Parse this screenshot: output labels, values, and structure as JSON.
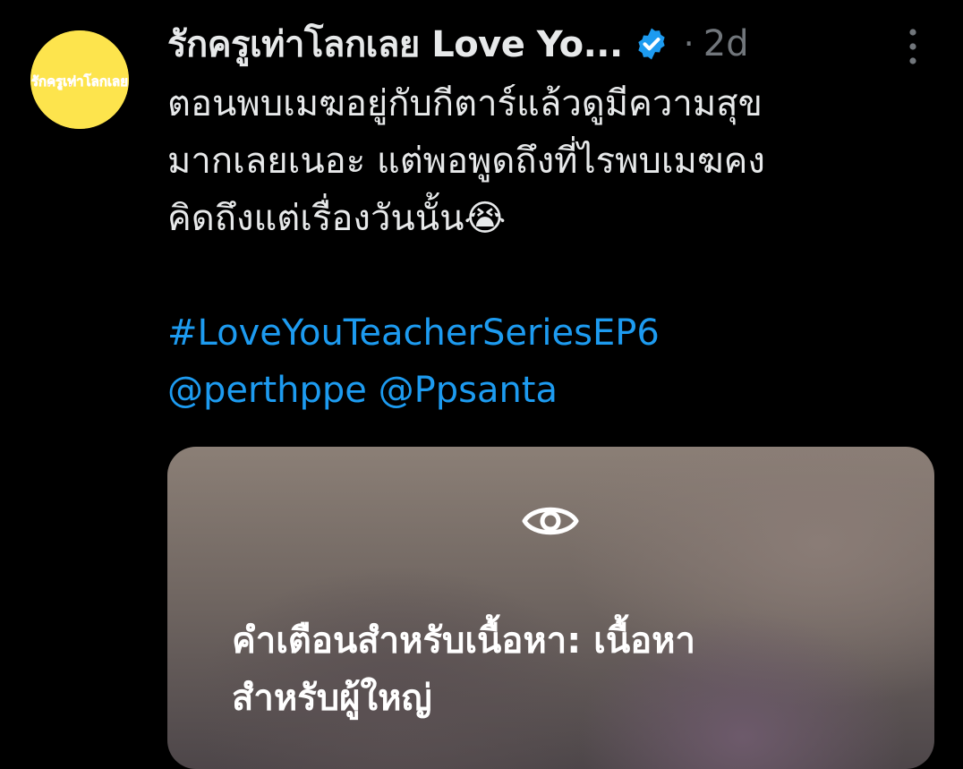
{
  "tweet": {
    "author": {
      "display_name": "รักครูเท่าโลกเลย Love Yo...",
      "avatar_text": "รักครูเท่าโลกเลย"
    },
    "separator": "·",
    "time": "2d",
    "text_lines": [
      "ตอนพบเมฆอยู่กับกีตาร์แล้วดูมีความสุข",
      "มากเลยเนอะ แต่พอพูดถึงที่ไรพบเมฆคง",
      "คิดถึงแต่เรื่องวันนั้น😭"
    ],
    "hashtag": "#LoveYouTeacherSeriesEP6",
    "mentions": [
      "@perthppe",
      "@Ppsanta"
    ],
    "media": {
      "warning_lines": [
        "คำเตือนสำหรับเนื้อหา: เนื้อหา",
        "สำหรับผู้ใหญ่"
      ]
    }
  },
  "icons": {
    "verified": "verified-badge-icon",
    "more": "more-vertical-icon",
    "eye": "eye-icon"
  },
  "colors": {
    "background": "#000000",
    "text": "#e7e9ea",
    "secondary": "#71767b",
    "link": "#1d9bf0",
    "verified": "#1d9bf0",
    "avatar_bg": "#fde44d"
  }
}
